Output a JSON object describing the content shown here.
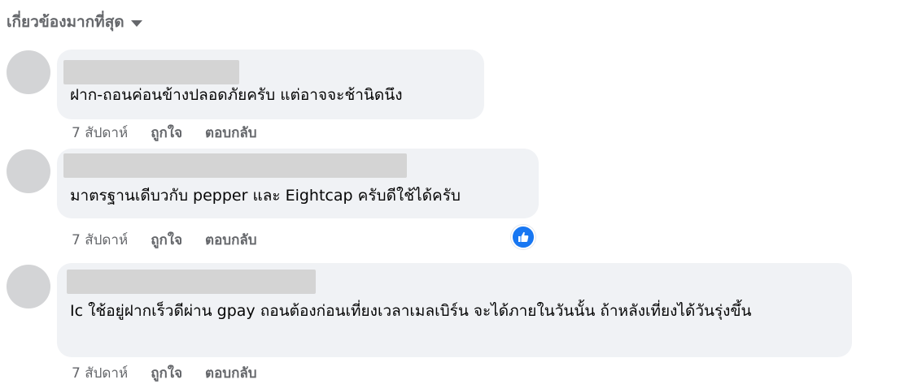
{
  "sort": {
    "label": "เกี่ยวข้องมากที่สุด",
    "icon": "caret-down-icon"
  },
  "comments": [
    {
      "name": "",
      "text": "ฝาก-ถอนค่อนข้างปลอดภัยครับ แต่อาจจะช้านิดนึง",
      "time": "7 สัปดาห์",
      "like_label": "ถูกใจ",
      "reply_label": "ตอบกลับ",
      "has_like_reaction": false
    },
    {
      "name": "",
      "text": "มาตรฐานเดีบวกับ pepper และ Eightcap ครับดีใช้ได้ครับ",
      "time": "7 สัปดาห์",
      "like_label": "ถูกใจ",
      "reply_label": "ตอบกลับ",
      "has_like_reaction": true
    },
    {
      "name": "",
      "text": "Ic ใช้อยู่ฝากเร็วดีผ่าน gpay ถอนต้องก่อนเที่ยงเวลาเมลเบิร์น จะได้ภายในวันนั้น ถ้าหลังเที่ยงได้วันรุ่งขึ้น",
      "time": "7 สัปดาห์",
      "like_label": "ถูกใจ",
      "reply_label": "ตอบกลับ",
      "has_like_reaction": false
    }
  ],
  "colors": {
    "bubble": "#f0f2f5",
    "secondary_text": "#65676b",
    "like_blue": "#1877f2",
    "avatar_placeholder": "#d3d4d6",
    "name_redaction": "#d4d4d4"
  }
}
